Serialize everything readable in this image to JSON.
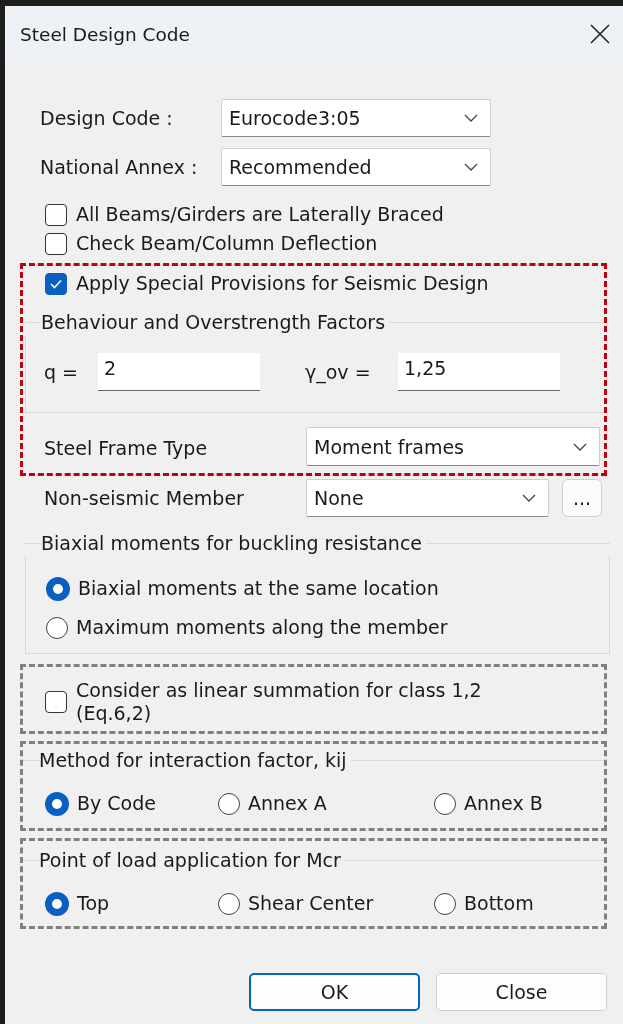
{
  "window": {
    "title": "Steel Design Code"
  },
  "fields": [
    {
      "label": "Design Code :",
      "value": "Eurocode3:05"
    },
    {
      "label": "National Annex :",
      "value": "Recommended"
    }
  ],
  "checkboxes": [
    {
      "label": "All Beams/Girders are Laterally Braced",
      "checked": false
    },
    {
      "label": "Check Beam/Column Deflection",
      "checked": false
    }
  ],
  "seismic": {
    "color": "#c00010",
    "checkbox": {
      "label": "Apply Special Provisions for Seismic Design",
      "checked": true
    },
    "factors": {
      "title": "Behaviour and Overstrength Factors",
      "inputs": [
        {
          "label": "q =",
          "value": "2"
        },
        {
          "label": "γ_ov =",
          "value": "1,25"
        }
      ]
    },
    "frame_type": {
      "label": "Steel Frame Type",
      "value": "Moment frames"
    }
  },
  "non_seismic": {
    "label": "Non-seismic Member",
    "value": "None",
    "button": "..."
  },
  "biaxial": {
    "title": "Biaxial moments for buckling resistance",
    "options": [
      {
        "label": "Biaxial moments at the same location",
        "selected": true
      },
      {
        "label": "Maximum moments along the member",
        "selected": false
      }
    ]
  },
  "linear_summation": {
    "color": "#808080",
    "label": "Consider as linear summation for class 1,2\n(Eq.6,2)",
    "checked": false
  },
  "interaction": {
    "color": "#808080",
    "title": "Method for interaction factor, kij",
    "options": [
      {
        "label": "By Code",
        "selected": true
      },
      {
        "label": "Annex A",
        "selected": false
      },
      {
        "label": "Annex B",
        "selected": false
      }
    ]
  },
  "load_point": {
    "color": "#808080",
    "title": "Point of load application for Mcr",
    "options": [
      {
        "label": "Top",
        "selected": true
      },
      {
        "label": "Shear Center",
        "selected": false
      },
      {
        "label": "Bottom",
        "selected": false
      }
    ]
  },
  "buttons": [
    {
      "label": "OK",
      "default": true
    },
    {
      "label": "Close",
      "default": false
    }
  ]
}
